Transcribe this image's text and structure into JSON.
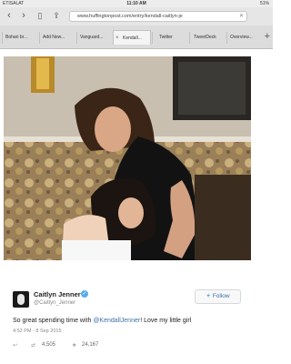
{
  "status_bar": {
    "carrier": "ETISALAT",
    "time": "11:10 AM",
    "battery": "51%"
  },
  "browser": {
    "url": "www.huffingtonpost.com/entry/kendall-caitlyn-je",
    "tabs": [
      {
        "label": "Bohari br..."
      },
      {
        "label": "Add New..."
      },
      {
        "label": "Vanguard..."
      },
      {
        "label": "Kendall..."
      },
      {
        "label": "Twitter"
      },
      {
        "label": "TweetDeck"
      },
      {
        "label": "Overview..."
      }
    ],
    "active_tab_index": 3
  },
  "tweet": {
    "name": "Caitlyn Jenner",
    "handle": "@Caitlyn_Jenner",
    "follow_label": "Follow",
    "text_before": "So great spending time with ",
    "mention": "@KendallJenner",
    "text_after": "! Love my little girl",
    "timestamp": "4:52 PM - 8 Sep 2015",
    "retweets": "4,505",
    "likes": "24,167"
  },
  "icons": {
    "back": "back-arrow-icon",
    "forward": "forward-arrow-icon",
    "bookmarks": "bookmarks-icon",
    "share": "share-icon",
    "new_tab": "plus-icon",
    "retweet": "retweet-icon",
    "like": "star-icon",
    "reply": "reply-icon"
  },
  "colors": {
    "link": "#3d6fa8",
    "twitter_blue": "#55acee"
  }
}
